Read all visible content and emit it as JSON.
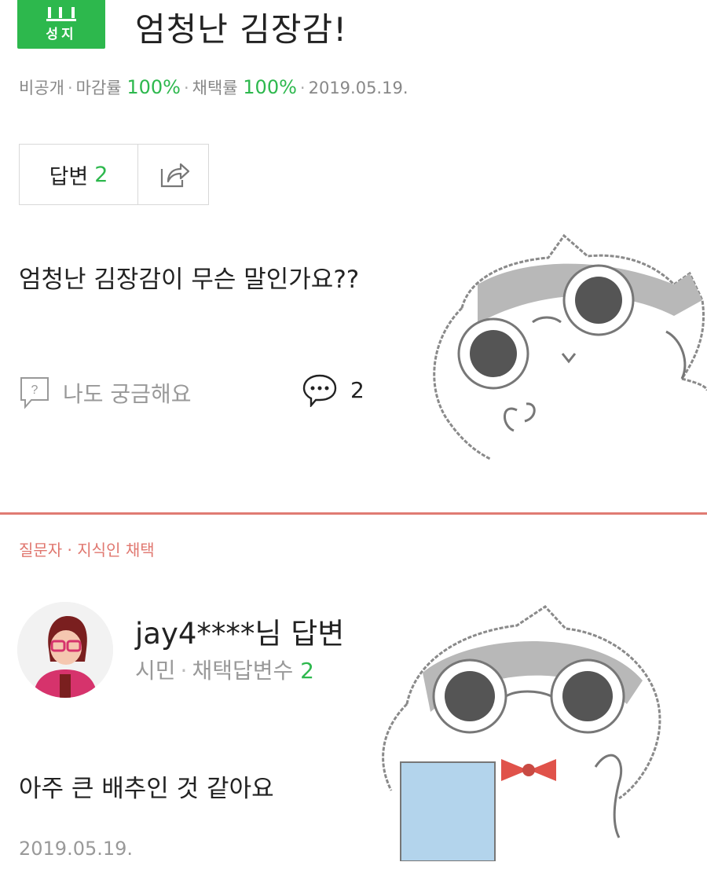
{
  "question": {
    "badge_label": "성지",
    "title": "엄청난 김장감!",
    "meta": {
      "visibility": "비공개",
      "close_rate_label": "마감률",
      "close_rate": "100%",
      "adopt_rate_label": "채택률",
      "adopt_rate": "100%",
      "date": "2019.05.19."
    },
    "answer_tab_label": "답변",
    "answer_count": "2",
    "body": "엄청난 김장감이 무슨 말인가요??",
    "curious_label": "나도 궁금해요",
    "comment_count": "2"
  },
  "answer": {
    "picked_label": "질문자 · 지식인 채택",
    "author": "jay4****님 답변",
    "rank": "시민",
    "adopted_label": "채택답변수",
    "adopted_count": "2",
    "body": "아주 큰 배추인 것 같아요",
    "date": "2019.05.19."
  },
  "colors": {
    "accent_green": "#2db84d",
    "accent_red": "#e0776f",
    "muted": "#999999"
  },
  "icons": [
    "share-icon",
    "question-bubble-icon",
    "comment-bubble-icon",
    "jisik-badge-icon"
  ]
}
